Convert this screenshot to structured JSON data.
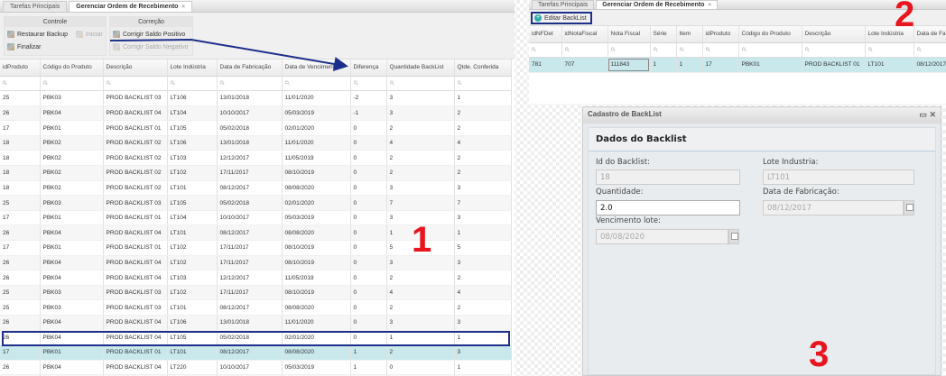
{
  "left": {
    "tabs": [
      {
        "label": "Tarefas Principais"
      },
      {
        "label": "Gerenciar Ordem de Recebimento",
        "close": "×"
      }
    ],
    "groups": {
      "controle": {
        "title": "Controle",
        "buttons": [
          "Restaurar Backup",
          "Iniciar",
          "Finalizar"
        ]
      },
      "correcao": {
        "title": "Correção",
        "buttons": [
          "Corrigir Saldo Positivo",
          "Corrigir Saldo Negativo"
        ]
      }
    },
    "columns": [
      "idProduto",
      "Código do Produto",
      "Descrição",
      "Lote Indústria",
      "Data de Fabricação",
      "Data de Vencimento",
      "Diferença",
      "Quantidade BackList",
      "Qtde. Conferida"
    ],
    "rows": [
      [
        "25",
        "PBK03",
        "PROD BACKLIST 03",
        "LT106",
        "13/01/2018",
        "11/01/2020",
        "-2",
        "3",
        "1"
      ],
      [
        "26",
        "PBK04",
        "PROD BACKLIST 04",
        "LT104",
        "10/10/2017",
        "05/03/2019",
        "-1",
        "3",
        "2"
      ],
      [
        "17",
        "PBK01",
        "PROD BACKLIST 01",
        "LT105",
        "05/02/2018",
        "02/01/2020",
        "0",
        "2",
        "2"
      ],
      [
        "18",
        "PBK02",
        "PROD BACKLIST 02",
        "LT106",
        "13/01/2018",
        "11/01/2020",
        "0",
        "4",
        "4"
      ],
      [
        "18",
        "PBK02",
        "PROD BACKLIST 02",
        "LT103",
        "12/12/2017",
        "11/05/2019",
        "0",
        "2",
        "2"
      ],
      [
        "18",
        "PBK02",
        "PROD BACKLIST 02",
        "LT102",
        "17/11/2017",
        "08/10/2019",
        "0",
        "2",
        "2"
      ],
      [
        "18",
        "PBK02",
        "PROD BACKLIST 02",
        "LT101",
        "08/12/2017",
        "08/08/2020",
        "0",
        "3",
        "3"
      ],
      [
        "25",
        "PBK03",
        "PROD BACKLIST 03",
        "LT105",
        "05/02/2018",
        "02/01/2020",
        "0",
        "7",
        "7"
      ],
      [
        "17",
        "PBK01",
        "PROD BACKLIST 01",
        "LT104",
        "10/10/2017",
        "05/03/2019",
        "0",
        "3",
        "3"
      ],
      [
        "26",
        "PBK04",
        "PROD BACKLIST 04",
        "LT101",
        "08/12/2017",
        "08/08/2020",
        "0",
        "1",
        "1"
      ],
      [
        "17",
        "PBK01",
        "PROD BACKLIST 01",
        "LT102",
        "17/11/2017",
        "08/10/2019",
        "0",
        "5",
        "5"
      ],
      [
        "26",
        "PBK04",
        "PROD BACKLIST 04",
        "LT102",
        "17/11/2017",
        "08/10/2019",
        "0",
        "3",
        "3"
      ],
      [
        "26",
        "PBK04",
        "PROD BACKLIST 04",
        "LT103",
        "12/12/2017",
        "11/05/2019",
        "0",
        "2",
        "2"
      ],
      [
        "25",
        "PBK03",
        "PROD BACKLIST 03",
        "LT102",
        "17/11/2017",
        "08/10/2019",
        "0",
        "4",
        "4"
      ],
      [
        "25",
        "PBK03",
        "PROD BACKLIST 03",
        "LT101",
        "08/12/2017",
        "08/08/2020",
        "0",
        "2",
        "2"
      ],
      [
        "26",
        "PBK04",
        "PROD BACKLIST 04",
        "LT106",
        "13/01/2018",
        "11/01/2020",
        "0",
        "3",
        "3"
      ],
      [
        "26",
        "PBK04",
        "PROD BACKLIST 04",
        "LT105",
        "05/02/2018",
        "02/01/2020",
        "0",
        "1",
        "1"
      ],
      [
        "17",
        "PBK01",
        "PROD BACKLIST 01",
        "LT101",
        "08/12/2017",
        "08/08/2020",
        "1",
        "2",
        "3"
      ],
      [
        "26",
        "PBK04",
        "PROD BACKLIST 04",
        "LT220",
        "10/10/2017",
        "05/03/2019",
        "1",
        "0",
        "1"
      ],
      [
        "25",
        "PBK03",
        "PROD BACKLIST 03",
        "LT103",
        "12/12/2017",
        "11/05/2019",
        "2",
        "1",
        "3"
      ]
    ],
    "selected_row": 17,
    "step_label": "1"
  },
  "right": {
    "tabs": [
      {
        "label": "Tarefas Principais"
      },
      {
        "label": "Gerenciar Ordem de Recebimento",
        "close": "×"
      }
    ],
    "edit_button": "Editar BackList",
    "columns": [
      "idNFDet",
      "idNotaFiscal",
      "Nota Fiscal",
      "Série",
      "Item",
      "idProduto",
      "Código do Produto",
      "Descrição",
      "Lote Indústria",
      "Data de Fa"
    ],
    "rows": [
      [
        "781",
        "707",
        "111843",
        "1",
        "1",
        "17",
        "PBK01",
        "PROD BACKLIST 01",
        "LT101",
        "08/12/2017"
      ]
    ],
    "step_label": "2"
  },
  "dialog": {
    "title": "Cadastro de BackList",
    "section": "Dados do Backlist",
    "fields": {
      "id_label": "Id do Backlist:",
      "id_value": "18",
      "lote_label": "Lote Industria:",
      "lote_value": "LT101",
      "qtd_label": "Quantidade:",
      "qtd_value": "2.0",
      "fab_label": "Data de Fabricação:",
      "fab_value": "08/12/2017",
      "venc_label": "Vencimento lote:",
      "venc_value": "08/08/2020"
    },
    "step_label": "3"
  },
  "colors": {
    "annotation_arrow": "#1c2f8a",
    "step_number": "#e8141e",
    "selected_row": "#c8e8ec"
  }
}
